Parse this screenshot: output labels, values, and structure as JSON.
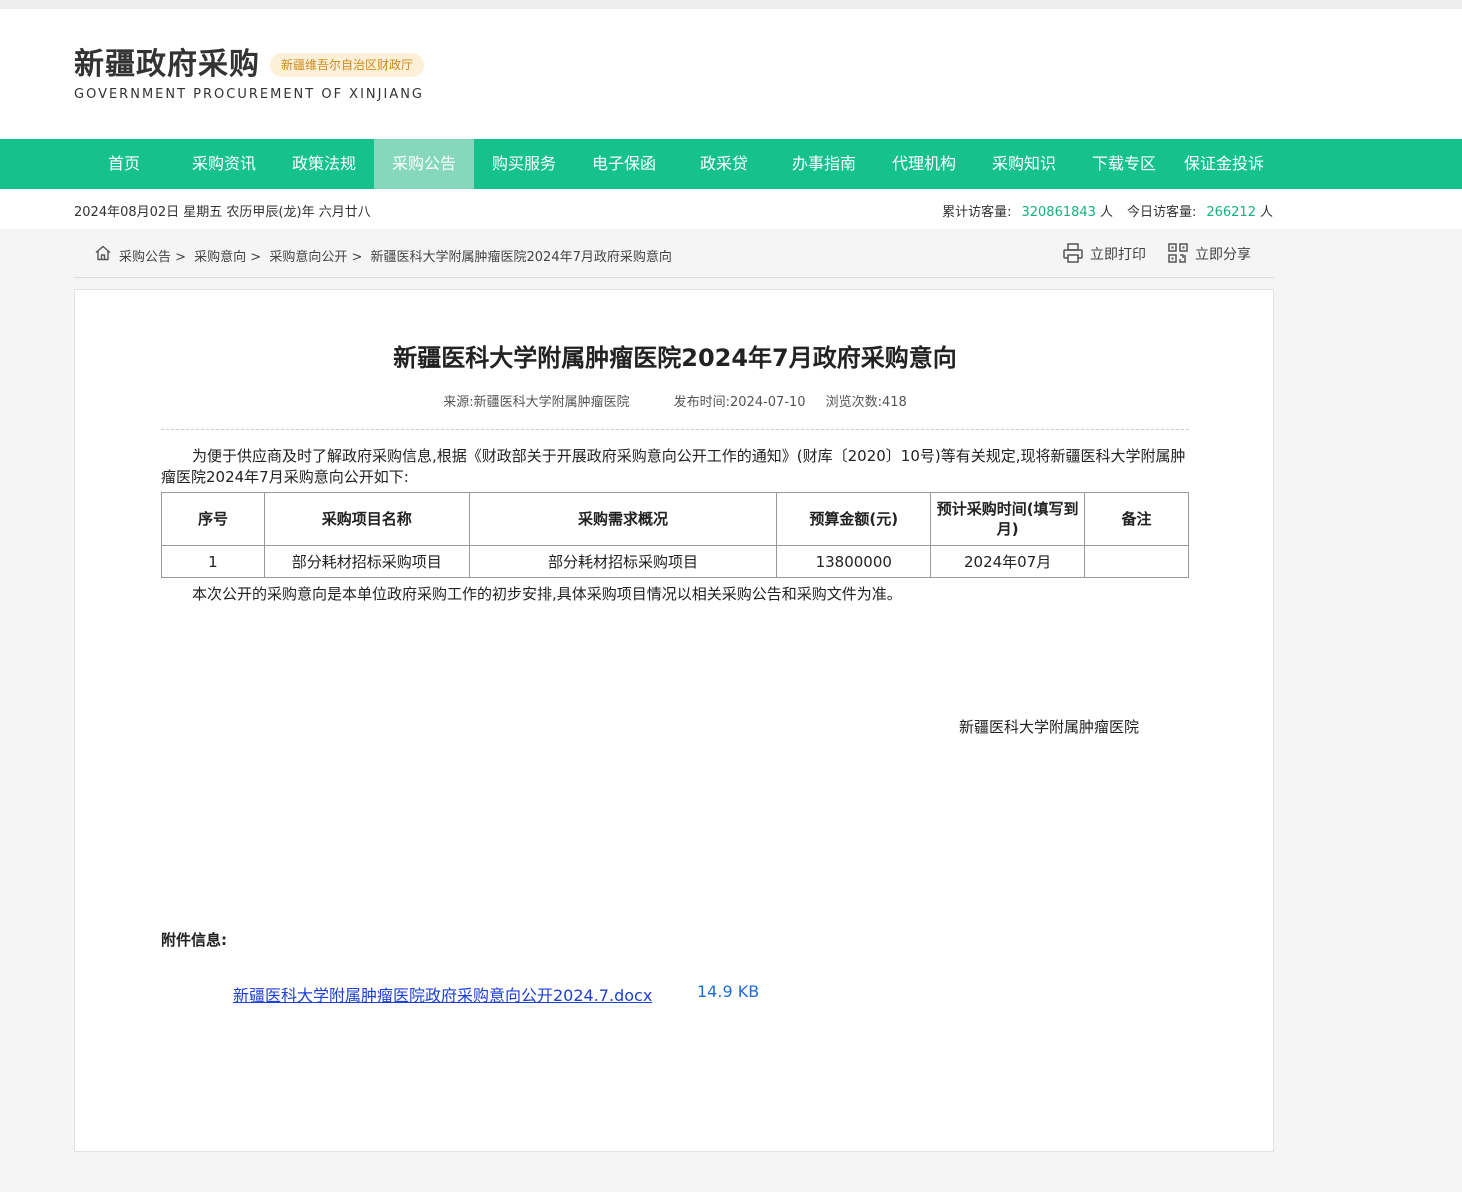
{
  "header": {
    "title": "新疆政府采购",
    "badge": "新疆维吾尔自治区财政厅",
    "subtitle": "GOVERNMENT PROCUREMENT OF XINJIANG"
  },
  "nav": {
    "items": [
      "首页",
      "采购资讯",
      "政策法规",
      "采购公告",
      "购买服务",
      "电子保函",
      "政采贷",
      "办事指南",
      "代理机构",
      "采购知识",
      "下载专区",
      "保证金投诉"
    ],
    "active": "采购公告"
  },
  "infobar": {
    "date": "2024年08月02日 星期五 农历甲辰(龙)年 六月廿八",
    "total_label": "累计访客量:",
    "total_value": "320861843",
    "today_label": "今日访客量:",
    "today_value": "266212",
    "unit": "人"
  },
  "breadcrumb": {
    "items": [
      "采购公告 >",
      "采购意向 >",
      "采购意向公开 >",
      "新疆医科大学附属肿瘤医院2024年7月政府采购意向"
    ],
    "print_label": "立即打印",
    "share_label": "立即分享"
  },
  "article": {
    "title": "新疆医科大学附属肿瘤医院2024年7月政府采购意向",
    "source": "来源:新疆医科大学附属肿瘤医院",
    "published": "发布时间:2024-07-10",
    "views": "浏览次数:418",
    "intro": "为便于供应商及时了解政府采购信息,根据《财政部关于开展政府采购意向公开工作的通知》(财库〔2020〕10号)等有关规定,现将新疆医科大学附属肿瘤医院2024年7月采购意向公开如下:",
    "table": {
      "headers": [
        "序号",
        "采购项目名称",
        "采购需求概况",
        "预算金额(元)",
        "预计采购时间(填写到月)",
        "备注"
      ],
      "rows": [
        [
          "1",
          "部分耗材招标采购项目",
          "部分耗材招标采购项目",
          "13800000",
          "2024年07月",
          ""
        ]
      ]
    },
    "note": "本次公开的采购意向是本单位政府采购工作的初步安排,具体采购项目情况以相关采购公告和采购文件为准。",
    "signer": "新疆医科大学附属肿瘤医院",
    "attachment_heading": "附件信息:",
    "attachment_name": "新疆医科大学附属肿瘤医院政府采购意向公开2024.7.docx",
    "attachment_size": "14.9 KB"
  },
  "colors": {
    "nav_bg": "#16c28b",
    "nav_active": "#85d8bb",
    "stat_number": "#16b07f",
    "link": "#1d3fd6"
  }
}
